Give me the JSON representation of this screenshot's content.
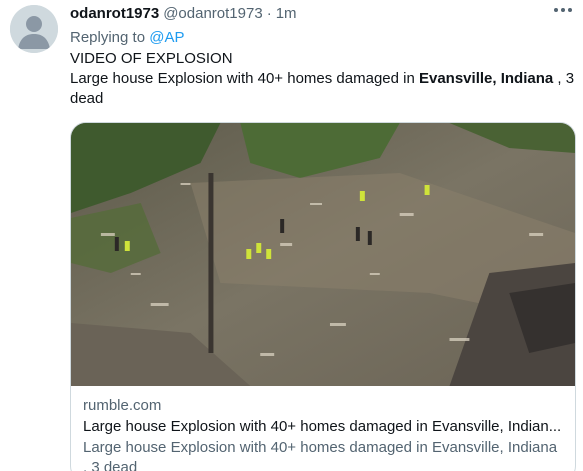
{
  "tweet": {
    "display_name": "odanrot1973",
    "handle": "@odanrot1973",
    "separator": "·",
    "time": "1m",
    "replying_prefix": "Replying to ",
    "replying_mention": "@AP",
    "line1": "VIDEO OF EXPLOSION",
    "line2_prefix": "Large house Explosion with 40+ homes damaged in ",
    "line2_bold": "Evansville, Indiana",
    "line2_suffix": " , 3 dead"
  },
  "card": {
    "image_icon": "explosion-aerial-photo",
    "domain": "rumble.com",
    "title": "Large house Explosion with 40+ homes damaged in Evansville, Indian...",
    "description": "Large house Explosion with 40+ homes damaged in Evansville, Indiana , 3 dead"
  },
  "icons": {
    "avatar": "default-avatar-icon",
    "more": "more-options-icon"
  },
  "colors": {
    "link": "#1d9bf0",
    "secondary_text": "#536471",
    "primary_text": "#0f1419",
    "border": "#cfd9de"
  }
}
